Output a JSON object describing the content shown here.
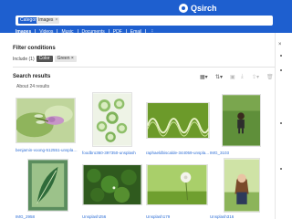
{
  "app": {
    "name": "Qsirch"
  },
  "search": {
    "chip_category": "Category",
    "chip_images": "Images",
    "chip_remove": "×"
  },
  "tabs": {
    "items": [
      "Images",
      "Videos",
      "Music",
      "Documents",
      "PDF",
      "Email"
    ],
    "active": "Images",
    "more": "⋮"
  },
  "filters": {
    "title": "Filter conditions",
    "include_label": "Include (1)",
    "chip_color": "Color",
    "chip_value": "Green",
    "chip_remove": "×"
  },
  "results": {
    "title": "Search results",
    "count": "About 24 results",
    "items": [
      {
        "caption": "benjamin-voong-512551-unsplash",
        "icon": "image-dragonfly"
      },
      {
        "caption": "foodbro360-397350-unsplash",
        "icon": "image-cucumber"
      },
      {
        "caption": "raphaeldbiscalde-344059-unspla...",
        "icon": "image-green-wave"
      },
      {
        "caption": "IMG_3103",
        "icon": "image-boy-grass"
      },
      {
        "caption": "IMG_2958",
        "icon": "image-leaf-art"
      },
      {
        "caption": "Unsplash256",
        "icon": "image-moss"
      },
      {
        "caption": "Unsplash179",
        "icon": "image-dandelion"
      },
      {
        "caption": "Unsplash316",
        "icon": "image-woman-field"
      }
    ]
  },
  "toolbar": {
    "icons": [
      "grid-view-icon",
      "sort-icon",
      "select-all-icon",
      "download-icon",
      "share-icon",
      "delete-icon"
    ]
  },
  "colors": {
    "brand": "#1e5fcf",
    "link": "#2f6fd6"
  }
}
